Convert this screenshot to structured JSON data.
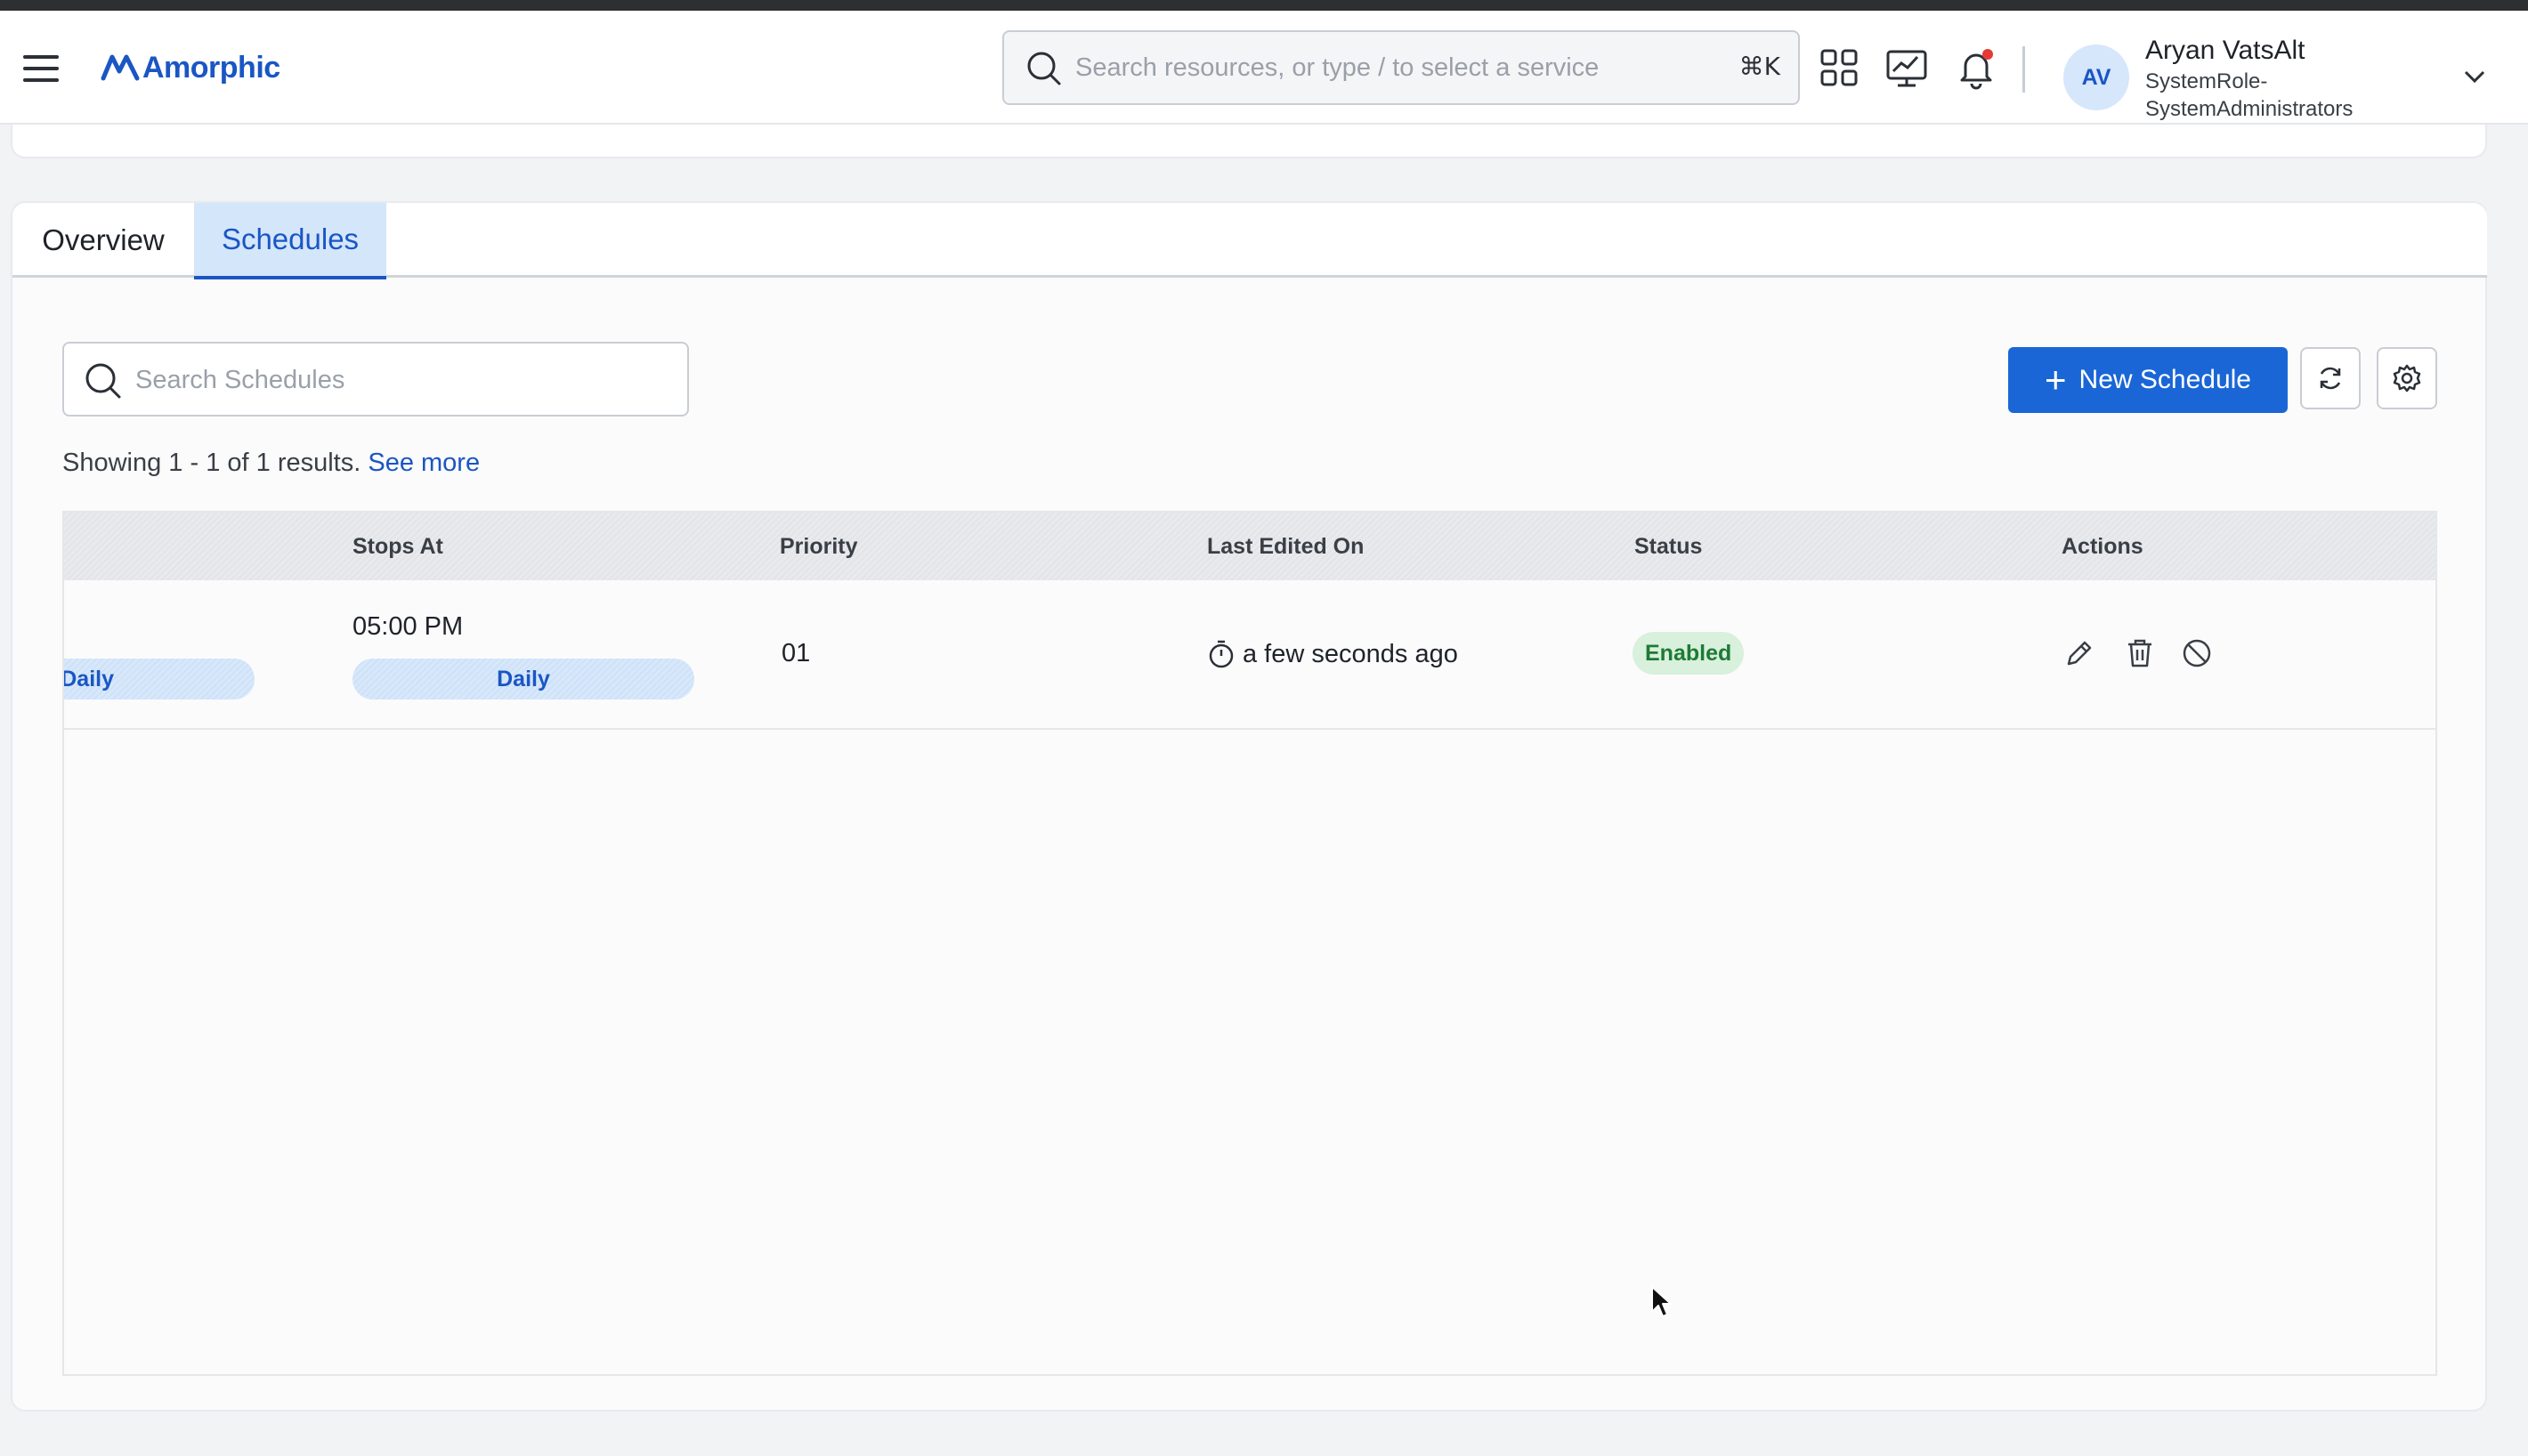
{
  "header": {
    "logo_text": "Amorphic",
    "search_placeholder": "Search resources, or type / to select a service",
    "search_shortcut": "⌘K",
    "icons": [
      "menu-icon",
      "apps-grid-icon",
      "monitor-chart-icon",
      "bell-icon",
      "chevron-down-icon"
    ],
    "user": {
      "initials": "AV",
      "name": "Aryan VatsAlt",
      "role_line1": "SystemRole-",
      "role_line2": "SystemAdministrators"
    }
  },
  "tabs": [
    {
      "label": "Overview",
      "active": false
    },
    {
      "label": "Schedules",
      "active": true
    }
  ],
  "toolbar": {
    "search_placeholder": "Search Schedules",
    "new_schedule_label": "New Schedule"
  },
  "results": {
    "text": "Showing 1 - 1 of 1 results.",
    "link": "See more"
  },
  "table": {
    "columns": [
      "Stops At",
      "Priority",
      "Last Edited On",
      "Status",
      "Actions"
    ],
    "rows": [
      {
        "start_pill": "Daily",
        "stops_at_time": "05:00 PM",
        "stops_at_pill": "Daily",
        "priority": "01",
        "last_edited": "a few seconds ago",
        "status": "Enabled",
        "actions": [
          "edit-icon",
          "delete-icon",
          "disable-icon"
        ]
      }
    ]
  },
  "colors": {
    "brand": "#1a56c4",
    "primary_button": "#1a66d6",
    "status_enabled_bg": "#d8f0dc",
    "status_enabled_text": "#1e7a35"
  }
}
